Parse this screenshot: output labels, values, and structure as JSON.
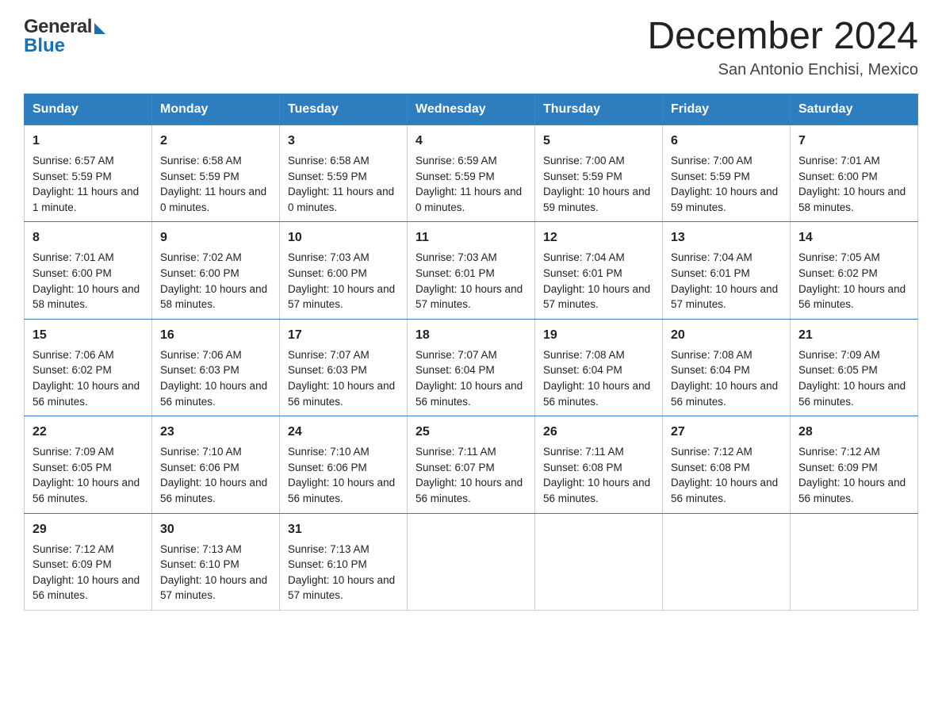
{
  "header": {
    "logo_general": "General",
    "logo_blue": "Blue",
    "month_title": "December 2024",
    "location": "San Antonio Enchisi, Mexico"
  },
  "days_of_week": [
    "Sunday",
    "Monday",
    "Tuesday",
    "Wednesday",
    "Thursday",
    "Friday",
    "Saturday"
  ],
  "weeks": [
    [
      {
        "day": "1",
        "sunrise": "6:57 AM",
        "sunset": "5:59 PM",
        "daylight": "11 hours and 1 minute."
      },
      {
        "day": "2",
        "sunrise": "6:58 AM",
        "sunset": "5:59 PM",
        "daylight": "11 hours and 0 minutes."
      },
      {
        "day": "3",
        "sunrise": "6:58 AM",
        "sunset": "5:59 PM",
        "daylight": "11 hours and 0 minutes."
      },
      {
        "day": "4",
        "sunrise": "6:59 AM",
        "sunset": "5:59 PM",
        "daylight": "11 hours and 0 minutes."
      },
      {
        "day": "5",
        "sunrise": "7:00 AM",
        "sunset": "5:59 PM",
        "daylight": "10 hours and 59 minutes."
      },
      {
        "day": "6",
        "sunrise": "7:00 AM",
        "sunset": "5:59 PM",
        "daylight": "10 hours and 59 minutes."
      },
      {
        "day": "7",
        "sunrise": "7:01 AM",
        "sunset": "6:00 PM",
        "daylight": "10 hours and 58 minutes."
      }
    ],
    [
      {
        "day": "8",
        "sunrise": "7:01 AM",
        "sunset": "6:00 PM",
        "daylight": "10 hours and 58 minutes."
      },
      {
        "day": "9",
        "sunrise": "7:02 AM",
        "sunset": "6:00 PM",
        "daylight": "10 hours and 58 minutes."
      },
      {
        "day": "10",
        "sunrise": "7:03 AM",
        "sunset": "6:00 PM",
        "daylight": "10 hours and 57 minutes."
      },
      {
        "day": "11",
        "sunrise": "7:03 AM",
        "sunset": "6:01 PM",
        "daylight": "10 hours and 57 minutes."
      },
      {
        "day": "12",
        "sunrise": "7:04 AM",
        "sunset": "6:01 PM",
        "daylight": "10 hours and 57 minutes."
      },
      {
        "day": "13",
        "sunrise": "7:04 AM",
        "sunset": "6:01 PM",
        "daylight": "10 hours and 57 minutes."
      },
      {
        "day": "14",
        "sunrise": "7:05 AM",
        "sunset": "6:02 PM",
        "daylight": "10 hours and 56 minutes."
      }
    ],
    [
      {
        "day": "15",
        "sunrise": "7:06 AM",
        "sunset": "6:02 PM",
        "daylight": "10 hours and 56 minutes."
      },
      {
        "day": "16",
        "sunrise": "7:06 AM",
        "sunset": "6:03 PM",
        "daylight": "10 hours and 56 minutes."
      },
      {
        "day": "17",
        "sunrise": "7:07 AM",
        "sunset": "6:03 PM",
        "daylight": "10 hours and 56 minutes."
      },
      {
        "day": "18",
        "sunrise": "7:07 AM",
        "sunset": "6:04 PM",
        "daylight": "10 hours and 56 minutes."
      },
      {
        "day": "19",
        "sunrise": "7:08 AM",
        "sunset": "6:04 PM",
        "daylight": "10 hours and 56 minutes."
      },
      {
        "day": "20",
        "sunrise": "7:08 AM",
        "sunset": "6:04 PM",
        "daylight": "10 hours and 56 minutes."
      },
      {
        "day": "21",
        "sunrise": "7:09 AM",
        "sunset": "6:05 PM",
        "daylight": "10 hours and 56 minutes."
      }
    ],
    [
      {
        "day": "22",
        "sunrise": "7:09 AM",
        "sunset": "6:05 PM",
        "daylight": "10 hours and 56 minutes."
      },
      {
        "day": "23",
        "sunrise": "7:10 AM",
        "sunset": "6:06 PM",
        "daylight": "10 hours and 56 minutes."
      },
      {
        "day": "24",
        "sunrise": "7:10 AM",
        "sunset": "6:06 PM",
        "daylight": "10 hours and 56 minutes."
      },
      {
        "day": "25",
        "sunrise": "7:11 AM",
        "sunset": "6:07 PM",
        "daylight": "10 hours and 56 minutes."
      },
      {
        "day": "26",
        "sunrise": "7:11 AM",
        "sunset": "6:08 PM",
        "daylight": "10 hours and 56 minutes."
      },
      {
        "day": "27",
        "sunrise": "7:12 AM",
        "sunset": "6:08 PM",
        "daylight": "10 hours and 56 minutes."
      },
      {
        "day": "28",
        "sunrise": "7:12 AM",
        "sunset": "6:09 PM",
        "daylight": "10 hours and 56 minutes."
      }
    ],
    [
      {
        "day": "29",
        "sunrise": "7:12 AM",
        "sunset": "6:09 PM",
        "daylight": "10 hours and 56 minutes."
      },
      {
        "day": "30",
        "sunrise": "7:13 AM",
        "sunset": "6:10 PM",
        "daylight": "10 hours and 57 minutes."
      },
      {
        "day": "31",
        "sunrise": "7:13 AM",
        "sunset": "6:10 PM",
        "daylight": "10 hours and 57 minutes."
      },
      null,
      null,
      null,
      null
    ]
  ]
}
